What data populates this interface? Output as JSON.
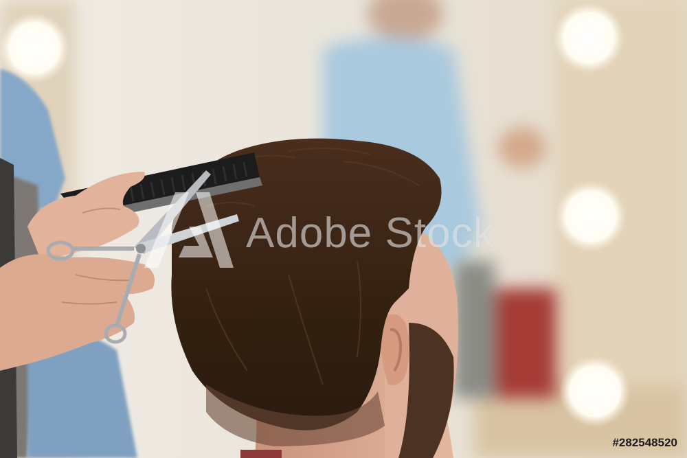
{
  "photo": {
    "subject": "barber-haircut"
  },
  "watermark": {
    "brand": "Adobe Stock",
    "stock_id": "#282548520"
  },
  "colors": {
    "hair": "#3a2417",
    "skin": "#d9a68a",
    "denim": "#8fb0cf",
    "bulb": "#fffdf6",
    "wall": "#ece7dd"
  }
}
